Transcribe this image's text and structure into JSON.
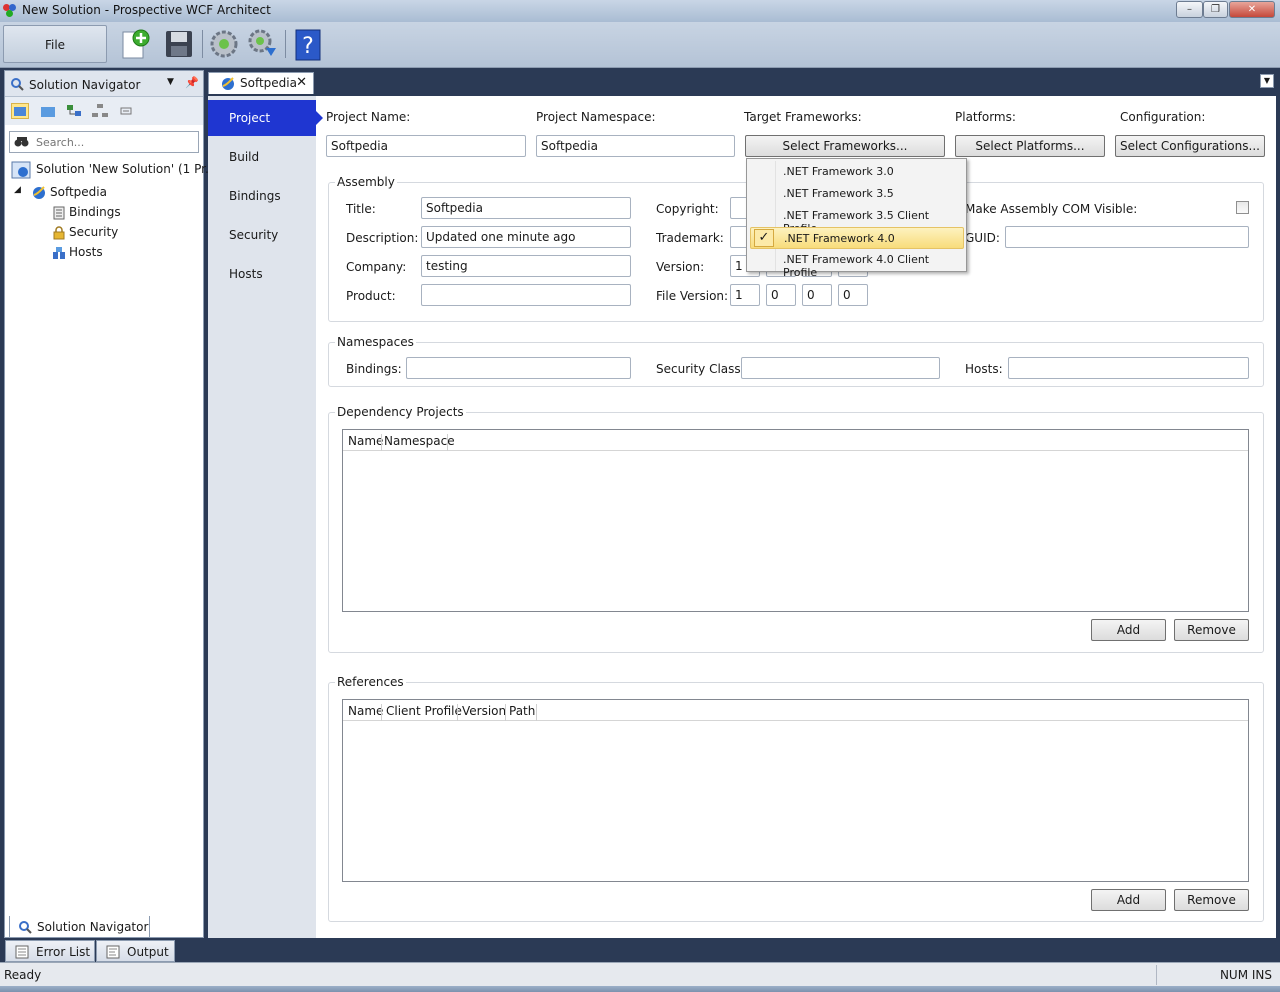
{
  "window": {
    "title": "New Solution - Prospective WCF Architect",
    "minimize": "–",
    "restore": "❐",
    "close": "✕"
  },
  "toolbar": {
    "file_label": "File",
    "icons": [
      "new-item-icon",
      "save-icon",
      "build-icon",
      "deploy-icon",
      "help-icon"
    ]
  },
  "navigator": {
    "title": "Solution Navigator",
    "search_placeholder": "Search...",
    "tree": {
      "solution": "Solution 'New Solution' (1 Pr...",
      "project": "Softpedia",
      "children": [
        "Bindings",
        "Security",
        "Hosts"
      ]
    },
    "bottom_tab": "Solution Navigator"
  },
  "bottom_tabs": [
    "Error List",
    "Output"
  ],
  "status": {
    "left": "Ready",
    "right": "NUM INS"
  },
  "document": {
    "tab_label": "Softpedia",
    "tab_close": "✕",
    "sidenav": [
      "Project",
      "Build",
      "Bindings",
      "Security",
      "Hosts"
    ],
    "project": {
      "name_label": "Project Name:",
      "name_value": "Softpedia",
      "namespace_label": "Project Namespace:",
      "namespace_value": "Softpedia",
      "frameworks_label": "Target Frameworks:",
      "frameworks_button": "Select Frameworks...",
      "platforms_label": "Platforms:",
      "platforms_button": "Select Platforms...",
      "config_label": "Configuration:",
      "config_button": "Select Configurations..."
    },
    "assembly": {
      "title": "Assembly",
      "title_label": "Title:",
      "title_value": "Softpedia",
      "description_label": "Description:",
      "description_value": "Updated one minute ago",
      "company_label": "Company:",
      "company_value": "testing",
      "product_label": "Product:",
      "product_value": "",
      "copyright_label": "Copyright:",
      "trademark_label": "Trademark:",
      "version_label": "Version:",
      "version_values": [
        "1",
        "",
        "",
        ""
      ],
      "file_version_label": "File Version:",
      "file_version_values": [
        "1",
        "0",
        "0",
        "0"
      ],
      "com_visible_label": "Make Assembly COM Visible:",
      "com_visible_checked": false,
      "guid_label": "GUID:",
      "guid_value": ""
    },
    "namespaces": {
      "title": "Namespaces",
      "bindings_label": "Bindings:",
      "security_label": "Security Class:",
      "hosts_label": "Hosts:"
    },
    "dependency_projects": {
      "title": "Dependency Projects",
      "columns": [
        "Name",
        "Namespace"
      ],
      "add_button": "Add",
      "remove_button": "Remove"
    },
    "references": {
      "title": "References",
      "columns": [
        "Name",
        "Client Profile",
        "Version",
        "Path"
      ],
      "add_button": "Add",
      "remove_button": "Remove"
    },
    "frameworks_popup": {
      "items": [
        {
          "label": ".NET Framework 3.0",
          "checked": false
        },
        {
          "label": ".NET Framework 3.5",
          "checked": false
        },
        {
          "label": ".NET Framework 3.5 Client Profile",
          "checked": false
        },
        {
          "label": ".NET Framework 4.0",
          "checked": true
        },
        {
          "label": ".NET Framework 4.0 Client Profile",
          "checked": false
        }
      ],
      "check_mark": "✓"
    }
  },
  "colors": {
    "active_nav": "#1f36d1",
    "app_background": "#2b3a55",
    "selection_highlight": "#f8dc7b"
  }
}
